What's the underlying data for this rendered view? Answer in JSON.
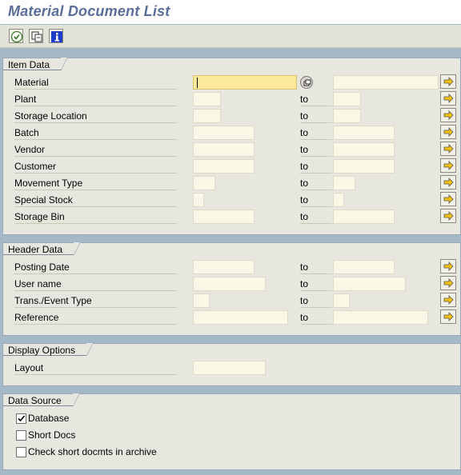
{
  "window": {
    "title": "Material Document List"
  },
  "toolbar": {
    "buttons": [
      {
        "name": "execute-button",
        "icon": "execute-icon"
      },
      {
        "name": "get-variant-button",
        "icon": "copy-variant-icon"
      },
      {
        "name": "info-button",
        "icon": "info-icon"
      }
    ]
  },
  "item_data": {
    "title": "Item Data",
    "rows": [
      {
        "label": "Material",
        "to": "",
        "low": "",
        "high": ""
      },
      {
        "label": "Plant",
        "to": "to",
        "low": "",
        "high": ""
      },
      {
        "label": "Storage Location",
        "to": "to",
        "low": "",
        "high": ""
      },
      {
        "label": "Batch",
        "to": "to",
        "low": "",
        "high": ""
      },
      {
        "label": "Vendor",
        "to": "to",
        "low": "",
        "high": ""
      },
      {
        "label": "Customer",
        "to": "to",
        "low": "",
        "high": ""
      },
      {
        "label": "Movement Type",
        "to": "to",
        "low": "",
        "high": ""
      },
      {
        "label": "Special Stock",
        "to": "to",
        "low": "",
        "high": ""
      },
      {
        "label": "Storage Bin",
        "to": "to",
        "low": "",
        "high": ""
      }
    ]
  },
  "header_data": {
    "title": "Header Data",
    "rows": [
      {
        "label": "Posting Date",
        "to": "to",
        "low": "",
        "high": ""
      },
      {
        "label": "User name",
        "to": "to",
        "low": "",
        "high": ""
      },
      {
        "label": "Trans./Event Type",
        "to": "to",
        "low": "",
        "high": ""
      },
      {
        "label": "Reference",
        "to": "to",
        "low": "",
        "high": ""
      }
    ]
  },
  "display_options": {
    "title": "Display Options",
    "layout_label": "Layout",
    "layout_value": ""
  },
  "data_source": {
    "title": "Data Source",
    "options": [
      {
        "label": "Database",
        "checked": true
      },
      {
        "label": "Short Docs",
        "checked": false
      },
      {
        "label": "Check short docmts in archive",
        "checked": false
      }
    ]
  },
  "colors": {
    "background": "#a5b8c8",
    "panel": "#e8e7df",
    "input": "#f9f8e6",
    "active_input": "#fce99a",
    "title": "#5a6e9c",
    "arrow": "#f3c20c"
  }
}
